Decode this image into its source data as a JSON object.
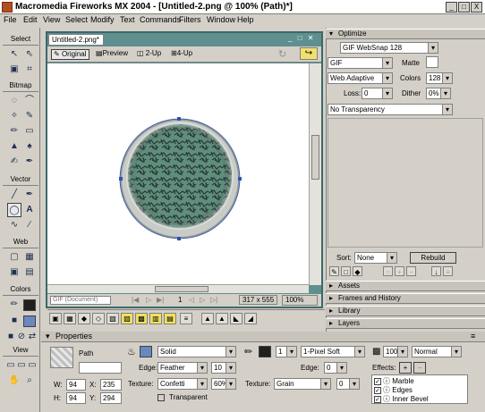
{
  "window": {
    "title": "Macromedia Fireworks MX 2004 - [Untitled-2.png @ 100% (Path)*]",
    "min": "_",
    "max": "□",
    "close": "X"
  },
  "menu": [
    "File",
    "Edit",
    "View",
    "Select",
    "Modify",
    "Text",
    "Commands",
    "Filters",
    "Window",
    "Help"
  ],
  "toolbox": {
    "sections": [
      "Select",
      "Bitmap",
      "Vector",
      "Web",
      "Colors",
      "View"
    ]
  },
  "document": {
    "tab": "Untitled-2.png*",
    "views": [
      "Original",
      "Preview",
      "2-Up",
      "4-Up"
    ],
    "status_format": "GIF (Document)",
    "page": "1",
    "size": "317 x 555",
    "zoom": "100%"
  },
  "optimize": {
    "header": "Optimize",
    "preset": "GIF WebSnap 128",
    "format": "GIF",
    "matte_label": "Matte",
    "palette": "Web Adaptive",
    "colors_label": "Colors",
    "colors_value": "128",
    "loss_label": "Loss:",
    "loss_value": "0",
    "dither_label": "Dither",
    "dither_value": "0%",
    "transparency": "No Transparency",
    "sort_label": "Sort:",
    "sort_value": "None",
    "rebuild": "Rebuild"
  },
  "panels": [
    "Assets",
    "Frames and History",
    "Library",
    "Layers"
  ],
  "properties": {
    "header": "Properties",
    "object": "Path",
    "w_label": "W:",
    "w_value": "94",
    "x_label": "X:",
    "x_value": "235",
    "h_label": "H:",
    "h_value": "94",
    "y_label": "Y:",
    "y_value": "294",
    "fill_type": "Solid",
    "edge_label": "Edge:",
    "edge_value": "Feather",
    "edge_amount": "10",
    "texture_label": "Texture:",
    "texture_value": "Confetti",
    "texture_pct": "60%",
    "transparent_label": "Transparent",
    "stroke_size": "1",
    "stroke_type": "1-Pixel Soft",
    "stroke_edge_label": "Edge:",
    "stroke_edge_value": "0",
    "stroke_texture_label": "Texture:",
    "stroke_texture_value": "Grain",
    "stroke_texture_amount": "0",
    "opacity": "100",
    "blend": "Normal",
    "effects_label": "Effects:",
    "effects": [
      "Marble",
      "Edges",
      "Inner Bevel"
    ]
  },
  "colors": {
    "fill": "#6a88c0",
    "stroke": "#202020",
    "canvas_bg": "#ffffff",
    "doc_frame": "#5f8f8f",
    "disc": "#4f7f6f"
  }
}
